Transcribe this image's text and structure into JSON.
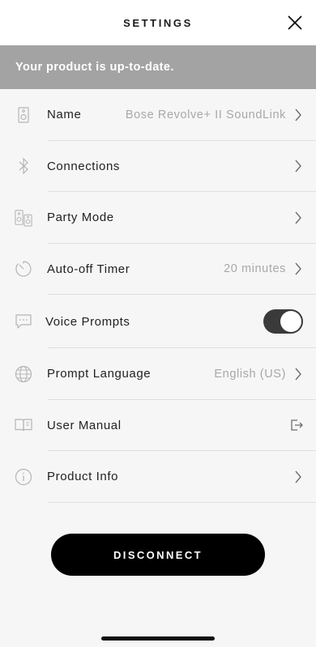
{
  "header": {
    "title": "SETTINGS"
  },
  "banner": {
    "text": "Your product is up-to-date."
  },
  "settings": {
    "items": [
      {
        "label": "Name",
        "value": "Bose Revolve+ II SoundLink",
        "icon": "speaker-icon"
      },
      {
        "label": "Connections",
        "value": "",
        "icon": "bluetooth-icon"
      },
      {
        "label": "Party Mode",
        "value": "",
        "icon": "party-mode-icon"
      },
      {
        "label": "Auto-off Timer",
        "value": "20 minutes",
        "icon": "timer-icon"
      },
      {
        "label": "Voice Prompts",
        "toggle": true,
        "icon": "speech-bubble-icon"
      },
      {
        "label": "Prompt Language",
        "value": "English (US)",
        "icon": "globe-icon"
      },
      {
        "label": "User Manual",
        "value": "",
        "icon": "book-icon"
      },
      {
        "label": "Product Info",
        "value": "",
        "icon": "info-icon"
      }
    ]
  },
  "actions": {
    "disconnect_label": "DISCONNECT"
  },
  "colors": {
    "banner": "#a3a3a3",
    "toggle_on": "#3a3a3a",
    "button": "#000000"
  }
}
